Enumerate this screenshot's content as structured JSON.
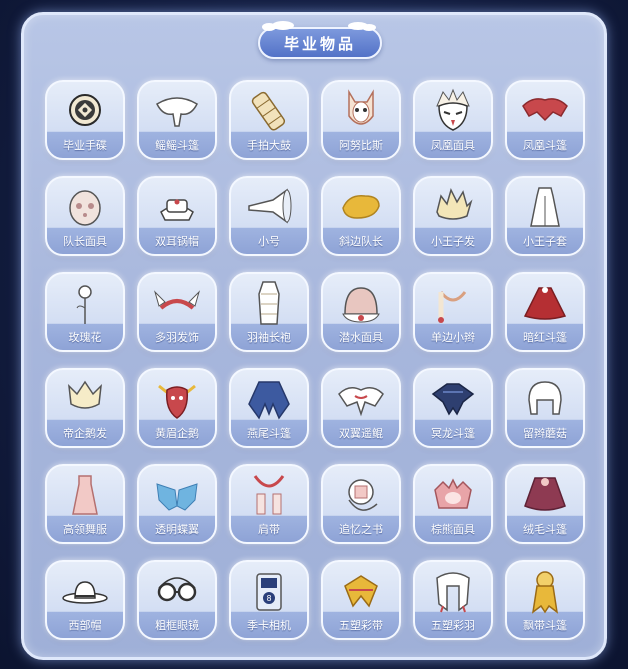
{
  "title": "毕业物品",
  "items": [
    {
      "label": "毕业手碟",
      "icon": "handpan-icon"
    },
    {
      "label": "鳐鳐斗篷",
      "icon": "manta-cape-icon"
    },
    {
      "label": "手拍大鼓",
      "icon": "drum-icon"
    },
    {
      "label": "阿努比斯",
      "icon": "anubis-mask-icon"
    },
    {
      "label": "凤凰面具",
      "icon": "phoenix-mask-icon"
    },
    {
      "label": "凤凰斗篷",
      "icon": "phoenix-cape-icon"
    },
    {
      "label": "队长面具",
      "icon": "captain-mask-icon"
    },
    {
      "label": "双耳锅帽",
      "icon": "pot-hat-icon"
    },
    {
      "label": "小号",
      "icon": "trumpet-icon"
    },
    {
      "label": "斜边队长",
      "icon": "bevel-captain-icon"
    },
    {
      "label": "小王子发",
      "icon": "little-prince-hair-icon"
    },
    {
      "label": "小王子套",
      "icon": "little-prince-outfit-icon"
    },
    {
      "label": "玫瑰花",
      "icon": "rose-icon"
    },
    {
      "label": "多羽发饰",
      "icon": "feather-headband-icon"
    },
    {
      "label": "羽袖长袍",
      "icon": "feather-robe-icon"
    },
    {
      "label": "潜水面具",
      "icon": "diving-mask-icon"
    },
    {
      "label": "单边小辫",
      "icon": "side-braid-icon"
    },
    {
      "label": "暗红斗篷",
      "icon": "dark-red-cape-icon"
    },
    {
      "label": "帝企鹅发",
      "icon": "penguin-hair-icon"
    },
    {
      "label": "黄眉企鹅",
      "icon": "penguin-mask-icon"
    },
    {
      "label": "燕尾斗篷",
      "icon": "swallowtail-cape-icon"
    },
    {
      "label": "双翼遥鲲",
      "icon": "winged-whale-cape-icon"
    },
    {
      "label": "冥龙斗篷",
      "icon": "krill-cape-icon"
    },
    {
      "label": "留辫蘑菇",
      "icon": "mushroom-hair-icon"
    },
    {
      "label": "高领舞服",
      "icon": "dance-outfit-icon"
    },
    {
      "label": "透明蝶翼",
      "icon": "butterfly-wings-icon"
    },
    {
      "label": "肩带",
      "icon": "shoulder-strap-icon"
    },
    {
      "label": "追忆之书",
      "icon": "memory-book-icon"
    },
    {
      "label": "棕熊面具",
      "icon": "bear-mask-icon"
    },
    {
      "label": "绒毛斗篷",
      "icon": "fluffy-cape-icon"
    },
    {
      "label": "西部帽",
      "icon": "cowboy-hat-icon"
    },
    {
      "label": "粗框眼镜",
      "icon": "glasses-icon"
    },
    {
      "label": "季卡相机",
      "icon": "camera-icon"
    },
    {
      "label": "五塑彩带",
      "icon": "ribbon-icon"
    },
    {
      "label": "五塑彩羽",
      "icon": "feather-hair-icon"
    },
    {
      "label": "飘带斗篷",
      "icon": "ribbon-cape-icon"
    }
  ],
  "colors": {
    "panel": "#a7b6dc",
    "title_pill": "#5f7ed0",
    "label_text": "#ffffff",
    "accent_red": "#c8484c",
    "accent_gold": "#e8b83a"
  }
}
